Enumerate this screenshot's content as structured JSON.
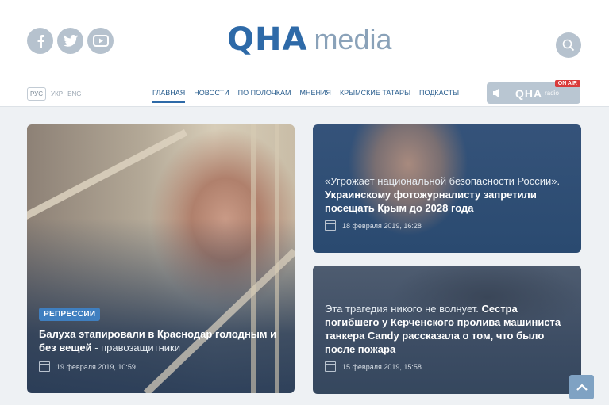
{
  "header": {
    "logo_mark": "QHA",
    "logo_word": "media",
    "social": [
      "facebook-icon",
      "twitter-icon",
      "youtube-icon"
    ],
    "langs": {
      "ru": "РУС",
      "ua": "УКР",
      "en": "ENG"
    },
    "nav": [
      "ГЛАВНАЯ",
      "НОВОСТИ",
      "ПО ПОЛОЧКАМ",
      "МНЕНИЯ",
      "КРЫМСКИЕ ТАТАРЫ",
      "ПОДКАСТЫ"
    ],
    "radio": {
      "logo": "QHA",
      "label": "radio",
      "badge": "ON AIR"
    }
  },
  "cards": {
    "main": {
      "tag": "РЕПРЕССИИ",
      "title_bold": "Балуха этапировали в Краснодар голодным и без вещей",
      "title_rest": " - правозащитники",
      "date": "19 февраля 2019, 10:59"
    },
    "top": {
      "title_lead": "«Угрожает национальной безопасности России».",
      "title_bold": "Украинскому фотожурналисту запретили посещать Крым до 2028 года",
      "date": "18 февраля 2019, 16:28"
    },
    "bottom": {
      "title_lead": "Эта трагедия никого не волнует.",
      "title_bold": "Сестра погибшего у Керченского пролива машиниста танкера Candy рассказала о том, что было после пожара",
      "date": "15 февраля 2019, 15:58"
    }
  },
  "colors": {
    "brand": "#2e6aa8",
    "tag": "#3f7fc0",
    "on_air": "#d93a3a"
  }
}
